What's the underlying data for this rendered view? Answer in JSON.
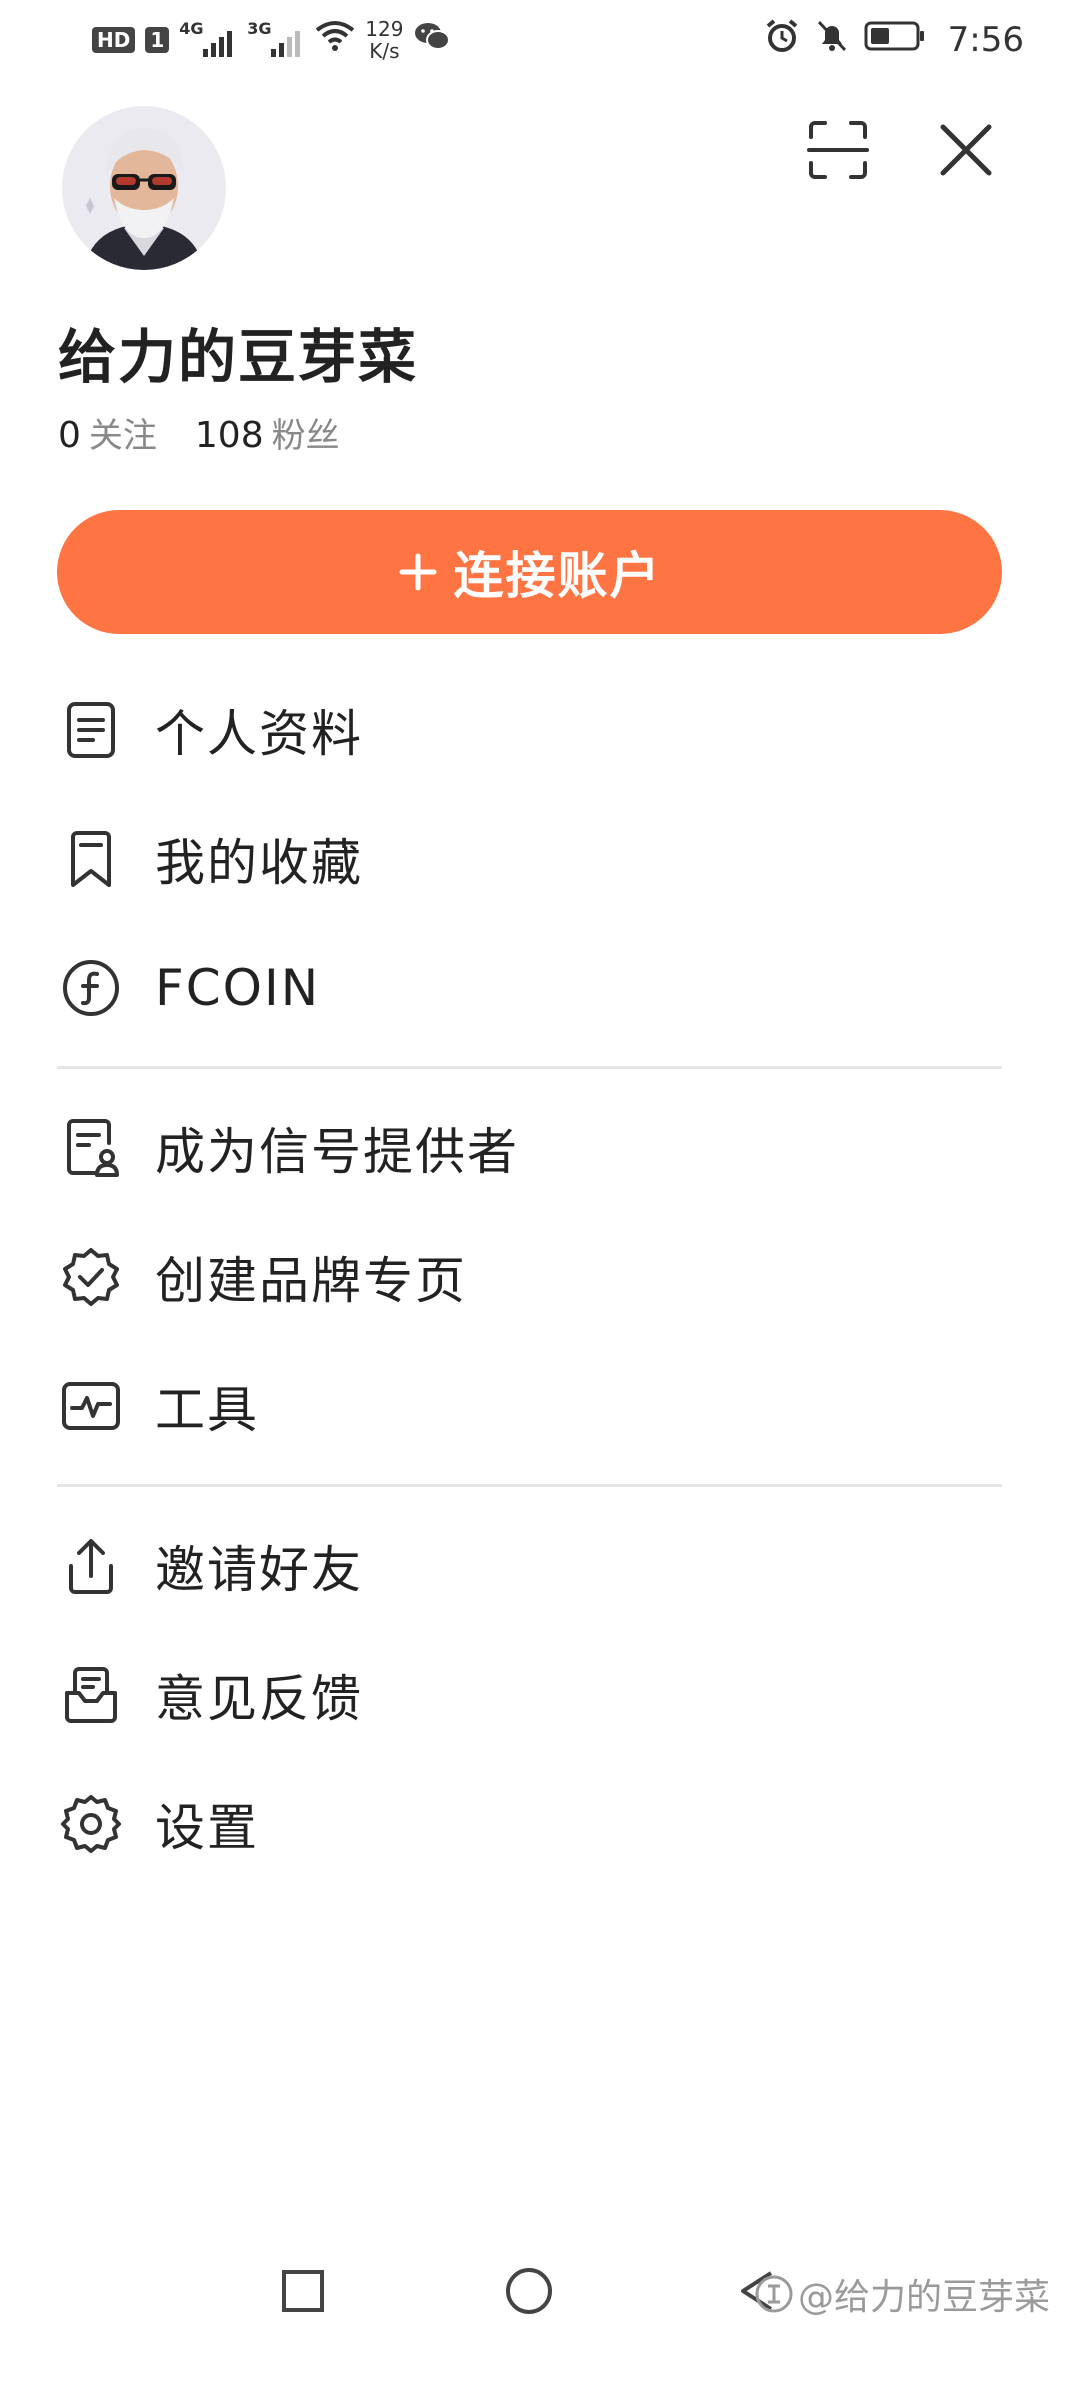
{
  "status_bar": {
    "badge_hd": "HD",
    "badge_sim": "1",
    "net1": "4G",
    "net2": "3G",
    "speed_value": "129",
    "speed_unit": "K/s",
    "time": "7:56"
  },
  "profile": {
    "username": "给力的豆芽菜",
    "following_count": "0",
    "following_label": "关注",
    "followers_count": "108",
    "followers_label": "粉丝"
  },
  "connect_button": {
    "label": "连接账户"
  },
  "menu_groups": [
    [
      {
        "label": "个人资料",
        "icon": "document-icon"
      },
      {
        "label": "我的收藏",
        "icon": "bookmark-icon"
      },
      {
        "label": "FCOIN",
        "icon": "coin-icon"
      }
    ],
    [
      {
        "label": "成为信号提供者",
        "icon": "signal-provider-icon"
      },
      {
        "label": "创建品牌专页",
        "icon": "verified-badge-icon"
      },
      {
        "label": "工具",
        "icon": "pulse-icon"
      }
    ],
    [
      {
        "label": "邀请好友",
        "icon": "share-icon"
      },
      {
        "label": "意见反馈",
        "icon": "feedback-icon"
      },
      {
        "label": "设置",
        "icon": "gear-icon"
      }
    ]
  ],
  "watermark": "@给力的豆芽菜",
  "colors": {
    "accent": "#ff7443",
    "text": "#222222",
    "muted": "#888888",
    "divider": "#e6e6e6"
  }
}
